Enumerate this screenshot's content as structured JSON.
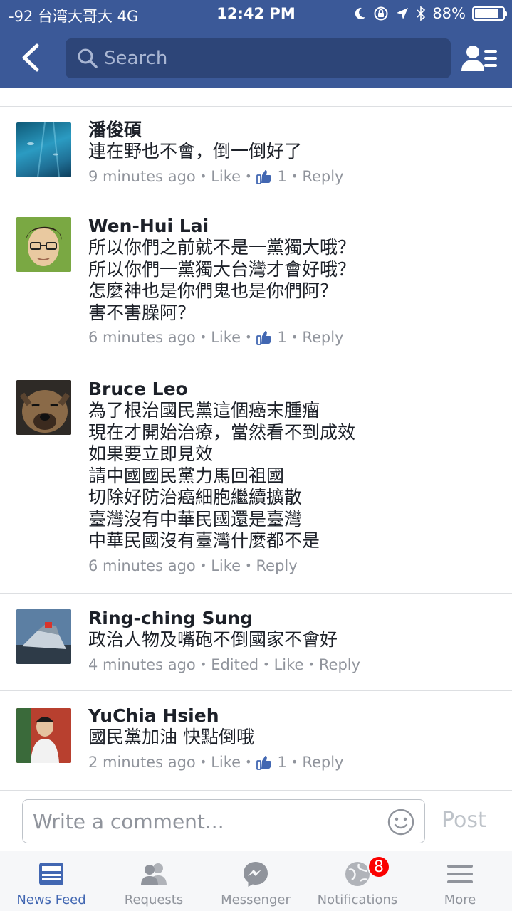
{
  "status_bar": {
    "carrier": "-92 台湾大哥大  4G",
    "time": "12:42 PM",
    "battery": "88%"
  },
  "nav": {
    "search_placeholder": "Search"
  },
  "comments": [
    {
      "name": "潘俊碩",
      "lines": [
        "連在野也不會，倒一倒好了"
      ],
      "time": "9 minutes ago",
      "like": "Like",
      "likes_count": "1",
      "reply": "Reply"
    },
    {
      "name": "Wen-Hui Lai",
      "lines": [
        "所以你們之前就不是一黨獨大哦？",
        "所以你們一黨獨大台灣才會好哦？",
        "怎麼神也是你們鬼也是你們阿？",
        "害不害臊阿？"
      ],
      "time": "6 minutes ago",
      "like": "Like",
      "likes_count": "1",
      "reply": "Reply"
    },
    {
      "name": "Bruce Leo",
      "lines": [
        "為了根治國民黨這個癌末腫瘤",
        "現在才開始治療，當然看不到成效",
        "如果要立即見效",
        "請中國國民黨力馬回祖國",
        "切除好防治癌細胞繼續擴散",
        "臺灣沒有中華民國還是臺灣",
        "中華民國沒有臺灣什麼都不是"
      ],
      "time": "6 minutes ago",
      "like": "Like",
      "reply": "Reply"
    },
    {
      "name": "Ring-ching Sung",
      "lines": [
        "政治人物及嘴砲不倒國家不會好"
      ],
      "time": "4 minutes ago",
      "edited": "Edited",
      "like": "Like",
      "reply": "Reply"
    },
    {
      "name": "YuChia Hsieh",
      "lines": [
        "國民黨加油 快點倒哦"
      ],
      "time": "2 minutes ago",
      "like": "Like",
      "likes_count": "1",
      "reply": "Reply"
    }
  ],
  "composer": {
    "placeholder": "Write a comment...",
    "post_label": "Post"
  },
  "tabs": [
    {
      "label": "News Feed",
      "icon": "news-feed-icon",
      "active": true
    },
    {
      "label": "Requests",
      "icon": "friend-requests-icon"
    },
    {
      "label": "Messenger",
      "icon": "messenger-icon"
    },
    {
      "label": "Notifications",
      "icon": "globe-icon",
      "badge": "8"
    },
    {
      "label": "More",
      "icon": "menu-icon"
    }
  ],
  "colors": {
    "brand": "#3b5998",
    "active_tab": "#4267b2",
    "badge": "#fa0000",
    "meta_text": "#90949c"
  }
}
